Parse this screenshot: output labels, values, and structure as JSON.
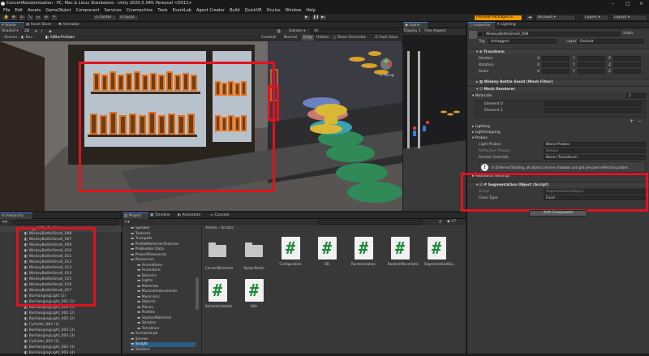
{
  "window": {
    "title": "ConcertRandomization - PC, Mac & Linux Standalone - Unity 2020.3.34f1 Personal <DX11>"
  },
  "menu": [
    "File",
    "Edit",
    "Assets",
    "GameObject",
    "Component",
    "Services",
    "Cinemachine",
    "Tools",
    "EventLab",
    "Agent Creator",
    "Build",
    "QuickVR",
    "Oculus",
    "Window",
    "Help"
  ],
  "toolbar": {
    "center": "Center",
    "local": "Local",
    "preview": "Preview Packages in Use",
    "account": "Account",
    "layers": "Layers",
    "layout": "Layout"
  },
  "scene_panel": {
    "tabs": [
      "Scene",
      "Asset Store",
      "Animator"
    ],
    "shading": "Shaded",
    "mode_2d": "2D",
    "gizmos": "Gizmos",
    "search_placeholder": "All",
    "breadcrumb": [
      "Scenes",
      "Bar",
      "AllBarPrefabs"
    ],
    "context_label": "Context:",
    "context_modes": [
      "Normal",
      "Gray",
      "Hidden"
    ],
    "show_overrides": "Show Overrides",
    "auto_save": "Auto Save",
    "persp": "< Persp"
  },
  "game_panel": {
    "tab": "Game",
    "display": "Display 1",
    "aspect": "Free Aspect"
  },
  "hierarchy": {
    "tab": "Hierarchy",
    "root": "AllBarPrefabs",
    "items": [
      "WiskeyBottleSmall_008",
      "WiskeyBottleSmall_007",
      "WiskeyBottleSmall_009",
      "WiskeyBottleSmall_010",
      "WiskeyBottleSmall_011",
      "WiskeyBottleSmall_012",
      "WiskeyBottleSmall_013",
      "WiskeyBottleSmall_014",
      "WiskeyBottleSmall_015",
      "WiskeyBottleSmall_016",
      "WiskeyBottleSmall_017",
      "BarHangingLight (1)",
      "BarHangingLight_002 (1)",
      "BarHangingLight_003 (1)",
      "BarHangingLight_002 (2)",
      "BarHangingLight_003 (2)",
      "Cylinder_002 (1)",
      "BarHangingLight_002 (3)",
      "BarHangingLight_003 (3)",
      "Cylinder_002 (2)",
      "BarHangingLight_002 (4)",
      "BarHangingLight_003 (4)"
    ]
  },
  "project": {
    "tabs": [
      "Project",
      "Timeline",
      "Animation",
      "Console"
    ],
    "tree": [
      "Speaker",
      "Textures",
      "Trumpets",
      "PrefabMaterialsTextures",
      "ProBuilder Data",
      "ProjectResources",
      "Resources",
      "Animations",
      "Animators",
      "Dancers",
      "Lights",
      "Materials",
      "MusicalInstruments",
      "Musicians",
      "Objects",
      "Places",
      "Profiles",
      "SkyboxMaterials",
      "Smokes",
      "Timelines",
      "ScenarioLab",
      "Scenes",
      "Scripts",
      "Shaders"
    ],
    "path": [
      "Assets",
      "Scripts"
    ],
    "files": [
      {
        "name": "ConcertElements",
        "kind": "folder"
      },
      {
        "name": "SpawnPoints",
        "kind": "folder"
      },
      {
        "name": "Configuration",
        "kind": "script"
      },
      {
        "name": "DB",
        "kind": "script"
      },
      {
        "name": "Randomization",
        "kind": "script"
      },
      {
        "name": "RandomPlacement",
        "kind": "script"
      },
      {
        "name": "SegmentationObj...",
        "kind": "script"
      },
      {
        "name": "SemanticLabeler",
        "kind": "script"
      },
      {
        "name": "Utils",
        "kind": "script"
      }
    ],
    "count": "17"
  },
  "inspector": {
    "tabs": [
      "Inspector",
      "Lighting"
    ],
    "object_name": "WiskeyBottleSmall_008",
    "static": "Static",
    "tag_label": "Tag",
    "tag": "Untagged",
    "layer_label": "Layer",
    "layer": "Default",
    "transform": {
      "title": "Transform",
      "rows": [
        "Position",
        "Rotation",
        "Scale"
      ],
      "axes": [
        "X",
        "Y",
        "Z"
      ]
    },
    "mesh_filter": "Wiskey Bottle Small (Mesh Filter)",
    "mesh_renderer": "Mesh Renderer",
    "materials": {
      "title": "Materials",
      "count": "2",
      "items": [
        "Element 0",
        "Element 1"
      ]
    },
    "lighting": "Lighting",
    "lightmapping": "Lightmapping",
    "probes": {
      "title": "Probes",
      "light_probes_label": "Light Probes",
      "light_probes": "Blend Probes",
      "reflection_label": "Reflection Probes",
      "reflection": "Simple",
      "anchor_label": "Anchor Override",
      "anchor": "None (Transform)"
    },
    "info": "In Deferred Shading, all objects receive shadows and get per-pixel reflection probes.",
    "additional": "Additional Settings",
    "segmentation": {
      "title": "Segmentation Object (Script)",
      "script_label": "Script",
      "script": "SegmentationObject",
      "class_label": "Class Type",
      "class_value": "Food"
    },
    "add_component": "Add Component"
  },
  "colors": {
    "highlight": "#e0131e",
    "accent": "#3a7ad8",
    "script_green": "#1f8a3a"
  }
}
